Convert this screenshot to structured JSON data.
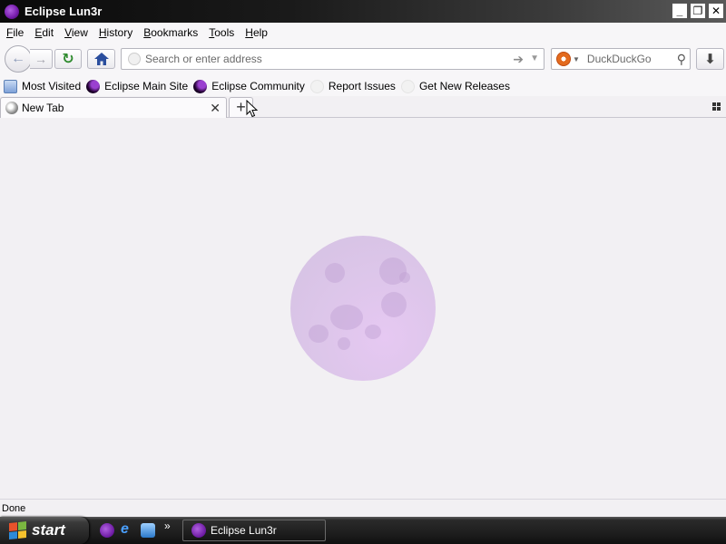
{
  "window": {
    "title": "Eclipse Lun3r",
    "minimize": "_",
    "restore": "❐",
    "close": "✕"
  },
  "menu": [
    "File",
    "Edit",
    "View",
    "History",
    "Bookmarks",
    "Tools",
    "Help"
  ],
  "nav": {
    "address_placeholder": "Search or enter address",
    "search_placeholder": "DuckDuckGo"
  },
  "bookmarks": [
    {
      "label": "Most Visited",
      "icon": "most-visited-icon"
    },
    {
      "label": "Eclipse Main Site",
      "icon": "eclipse-icon"
    },
    {
      "label": "Eclipse Community",
      "icon": "eclipse-icon"
    },
    {
      "label": "Report Issues",
      "icon": "blank-page-icon"
    },
    {
      "label": "Get New Releases",
      "icon": "blank-page-icon"
    }
  ],
  "tabs": [
    {
      "label": "New Tab"
    }
  ],
  "status": {
    "text": "Done"
  },
  "taskbar": {
    "start_label": "start",
    "quick_launch_more": "»",
    "tasks": [
      {
        "label": "Eclipse Lun3r"
      }
    ]
  }
}
